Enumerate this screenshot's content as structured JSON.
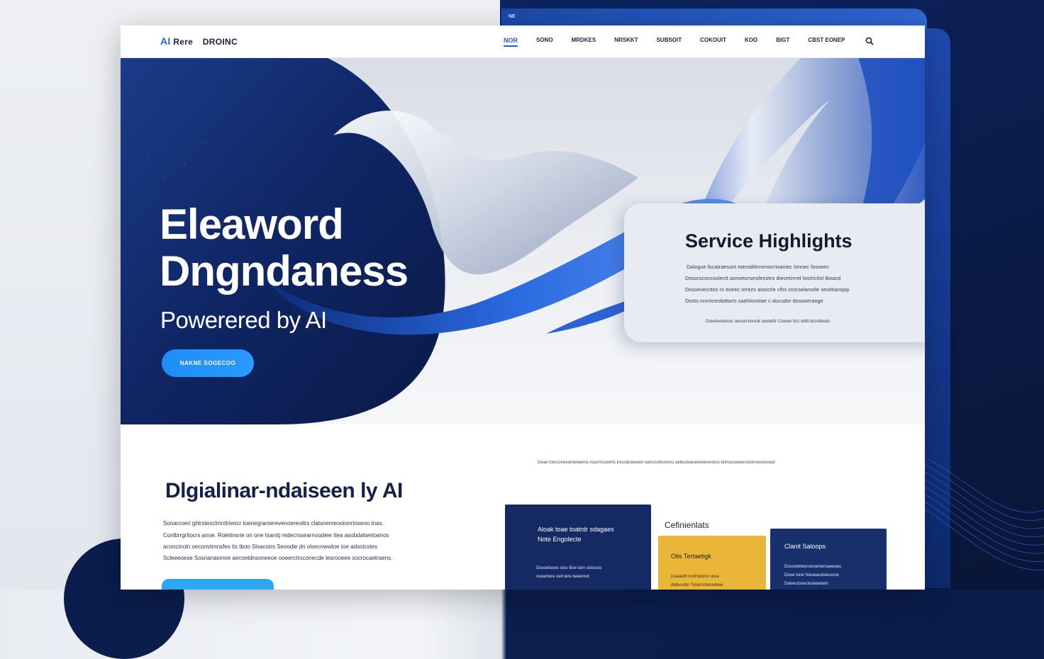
{
  "backdrop": {
    "tab_label": "NE"
  },
  "nav": {
    "logo_ai": "AI",
    "logo_text": "Rere",
    "brand": "DROINC",
    "items": [
      {
        "label": "NOR",
        "active": true
      },
      {
        "label": "SONO"
      },
      {
        "label": "MRDKES"
      },
      {
        "label": "NRSKKT"
      },
      {
        "label": "SUBSOIT"
      },
      {
        "label": "COKOUIT"
      },
      {
        "label": "KOO"
      },
      {
        "label": "BIGT"
      },
      {
        "label": "CBST EONEP"
      }
    ],
    "search_icon": "search-icon"
  },
  "hero": {
    "title_line1": "Eleaword",
    "title_line2": "Dngndaness",
    "subtitle": "Powerered by AI",
    "button_label": "NAKNE SOGECOO"
  },
  "services": {
    "title": "Service Highlights",
    "lines": [
      "Dalogue focatraessnt toerodttirnentorrioaniec lonnec fosseen",
      "Dosorsconcoolectt aoroetorsesilesotro diecetirrrel lostrictiol lboacd",
      "Dosoeveicttos rs eoeec orrezs aisncrle clhs cosrselanotle sesittiaropip",
      "Dosts nnrrticeobdtarts saehlovotae c docudor dosooeraoge"
    ],
    "footer": "Doeeleoeteres oessecnnorat oeotettlr Coeoer ttcs tettlt teciollieats"
  },
  "section": {
    "note_line": "Deae trensoneeonteleeens roanmsoeerls ireoraiowoeen laersrioheoreso aeleceoaoeeeoereodos tetnsesoeeorseorroeooeveel",
    "title": "Dlgialinar-ndaiseen ly AI",
    "paragraphs": [
      "Sooarcoeri ghtrstesclmntirieocr toenegrarserevenoereoitrs clatsnemeooionrtoseoo tnas.",
      "Conlbrrgrltocrs anoe. Roletinsrie on one tsarstj redecrssearnoodeie Itea asobdatwetoanos",
      "aconcinoln oeconvtrnnsfes tis tboo Slsacotrs Seoodie dn olsecnwwtoe toe adsoicstes",
      "Scleeeoese Sosnanaionoe aecoeldnsoneeoe ooeerctroconecde lesrooeee socrocaetraens."
    ]
  },
  "cards": {
    "a": {
      "title": "Aloak toae toatrdr sdagaes",
      "title2": "Note Engolecte",
      "p1": "Dosoetsoes stoo Boe tarn ostocsis",
      "p2": "Aoeertere oetl tere beeemot"
    },
    "b_heading": "Cefinienlats",
    "b": {
      "title": "Olis Tertaetigk",
      "p1": "Daaaeitt rostrsetonn orea",
      "p2": "daltecobn Toserontecadeee"
    },
    "c": {
      "title": "Clanit Saloops",
      "p1": "Dosooteteecoonemersaeeoes",
      "p2": "Dooe torer feleaseotoesvose",
      "p3": "Dalvectsoeclooeaetarls"
    }
  },
  "colors": {
    "accent": "#1e6fe0",
    "navy": "#0f2563",
    "button": "#1e8cf5",
    "gold": "#e9b63a"
  }
}
